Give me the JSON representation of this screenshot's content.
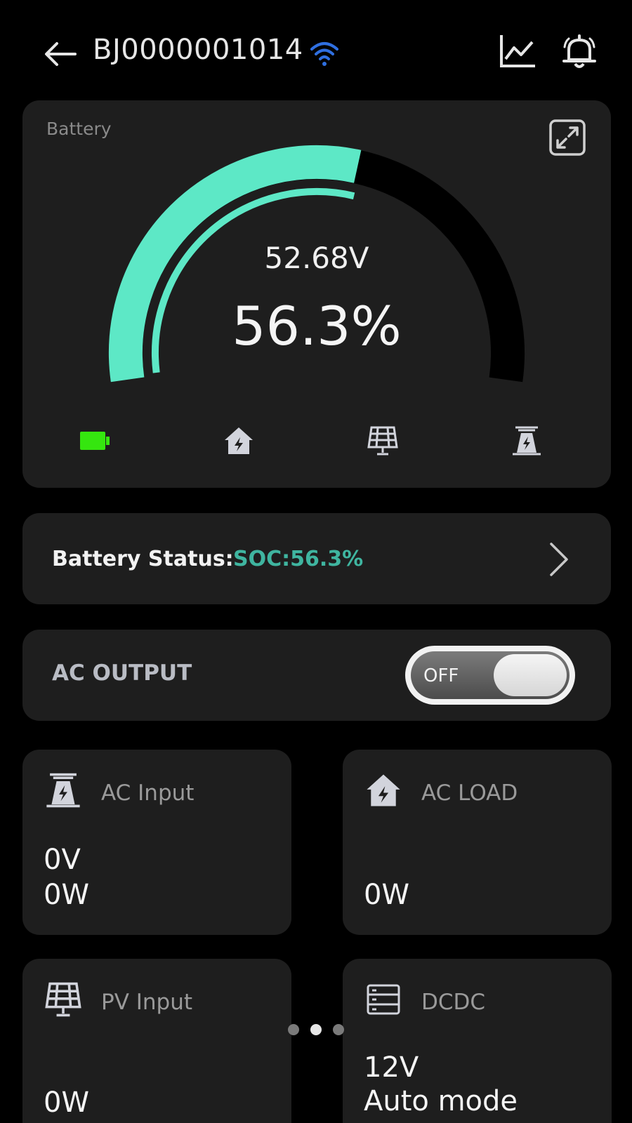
{
  "header": {
    "device_id": "BJ0000001014",
    "icons": [
      "back-arrow-icon",
      "wifi-icon",
      "line-chart-icon",
      "bell-icon"
    ]
  },
  "battery_card": {
    "label": "Battery",
    "voltage": "52.68V",
    "soc": "56.3%",
    "soc_fraction": 0.563,
    "gauge_color": "#5de8c6",
    "flow_icons": [
      "battery-icon",
      "home-icon",
      "solar-panel-icon",
      "grid-tower-icon"
    ],
    "battery_icon_color": "#35e60f"
  },
  "status_card": {
    "label": "Battery Status:",
    "value": "SOC:56.3%",
    "value_color": "#3fb5a0"
  },
  "ac_output": {
    "label": "AC OUTPUT",
    "toggle_text": "OFF"
  },
  "tiles": [
    {
      "title": "AC Input",
      "icon": "grid-tower-icon",
      "line1": "0V",
      "line2": "0W"
    },
    {
      "title": "AC LOAD",
      "icon": "home-icon",
      "line1": "",
      "line2": "0W"
    },
    {
      "title": "PV Input",
      "icon": "solar-panel-icon",
      "line1": "",
      "line2": "0W"
    },
    {
      "title": "DCDC",
      "icon": "dcdc-icon",
      "line1": "12V",
      "line2": "Auto mode"
    }
  ],
  "pager": {
    "count": 3,
    "active_index": 1
  }
}
